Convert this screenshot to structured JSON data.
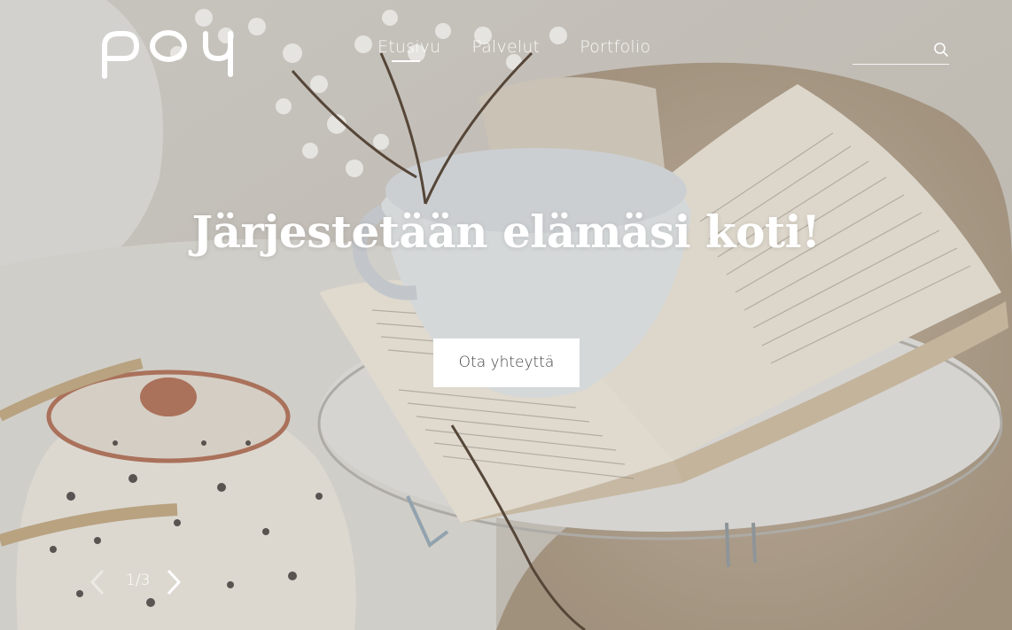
{
  "brand": {
    "logo_text": "pou"
  },
  "nav": {
    "items": [
      {
        "label": "Etusivu",
        "active": true
      },
      {
        "label": "Palvelut",
        "active": false
      },
      {
        "label": "Portfolio",
        "active": false
      }
    ]
  },
  "search": {
    "value": "",
    "icon": "search-icon"
  },
  "hero": {
    "headline": "Järjestetään elämäsi koti!",
    "cta_label": "Ota yhteyttä"
  },
  "slider": {
    "current": "1",
    "separator": "/",
    "total": "3",
    "prev_icon": "chevron-left-icon",
    "next_icon": "chevron-right-icon"
  },
  "colors": {
    "text": "#ffffff",
    "button_bg": "#ffffff",
    "button_text": "#444444"
  }
}
